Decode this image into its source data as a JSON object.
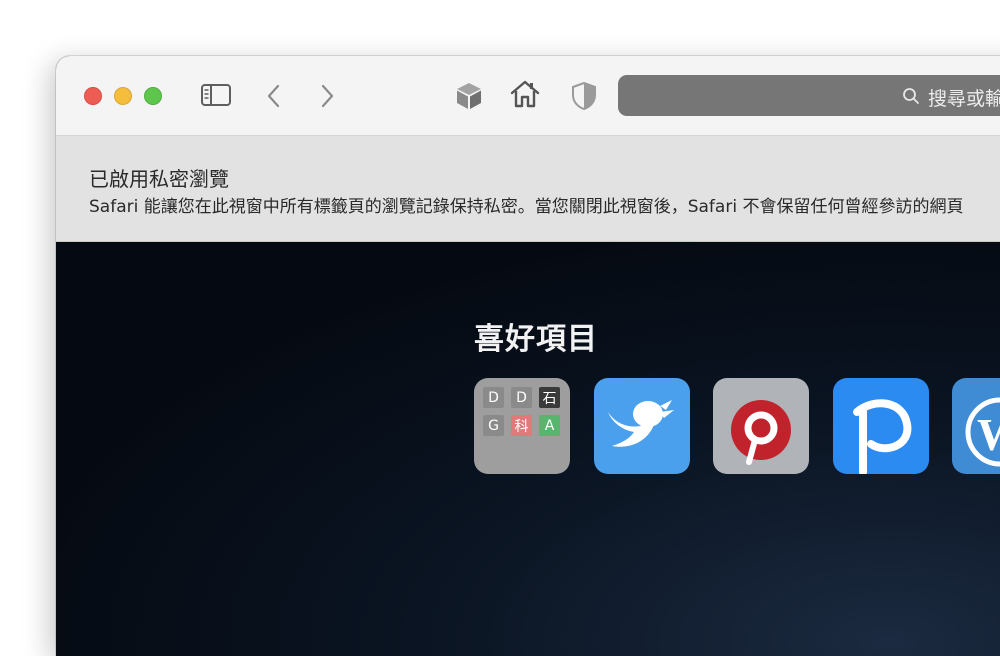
{
  "toolbar": {
    "search_placeholder": "搜尋或輸",
    "icons": [
      "sidebar-icon",
      "back-icon",
      "forward-icon",
      "cube-icon",
      "home-icon",
      "shield-icon",
      "search-icon"
    ]
  },
  "banner": {
    "title": "已啟用私密瀏覽",
    "description": "Safari 能讓您在此視窗中所有標籤頁的瀏覽記錄保持私密。當您關閉此視窗後，Safari 不會保留任何曾經參訪的網頁"
  },
  "favorites": {
    "title": "喜好項目",
    "tiles": [
      {
        "name": "ddg-tile",
        "cells": [
          "D",
          "D",
          "石",
          "G",
          "科",
          "A"
        ]
      },
      {
        "name": "twitter-tile"
      },
      {
        "name": "pinterest-tile"
      },
      {
        "name": "pixiv-tile"
      },
      {
        "name": "wordpress-tile"
      }
    ]
  },
  "colors": {
    "toolbar_bg": "#f4f4f4",
    "banner_bg": "#e2e2e2",
    "content_bg": "#060b14",
    "address_bar": "#767676",
    "close": "#ee5d54",
    "minimize": "#f4bd3c",
    "zoom": "#5ec54d"
  }
}
